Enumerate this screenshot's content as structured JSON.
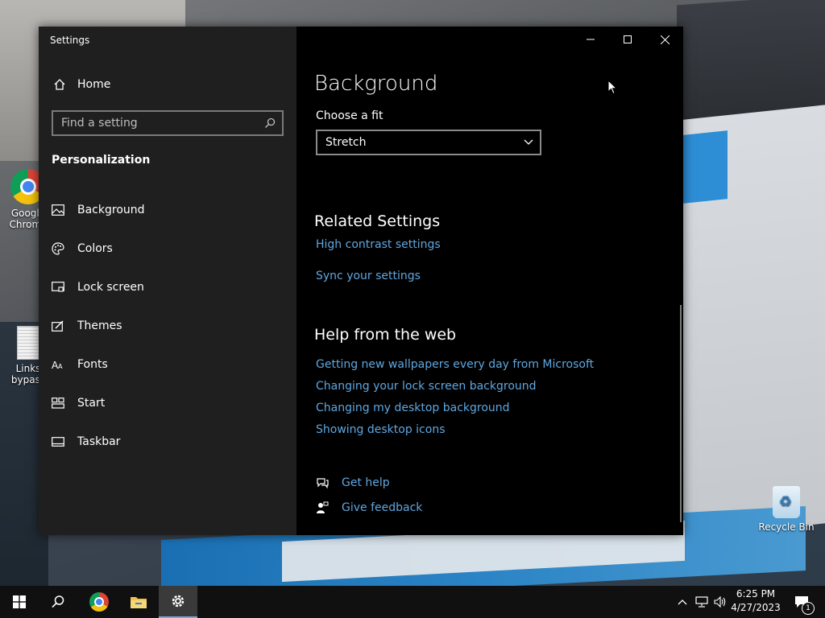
{
  "window": {
    "title": "Settings",
    "minimize_label": "Minimize",
    "maximize_label": "Maximize",
    "close_label": "Close"
  },
  "sidebar": {
    "home_label": "Home",
    "search_placeholder": "Find a setting",
    "section": "Personalization",
    "items": [
      {
        "label": "Background",
        "icon": "picture-icon"
      },
      {
        "label": "Colors",
        "icon": "palette-icon"
      },
      {
        "label": "Lock screen",
        "icon": "lock-screen-icon"
      },
      {
        "label": "Themes",
        "icon": "themes-icon"
      },
      {
        "label": "Fonts",
        "icon": "font-icon"
      },
      {
        "label": "Start",
        "icon": "start-icon"
      },
      {
        "label": "Taskbar",
        "icon": "taskbar-icon"
      }
    ]
  },
  "main": {
    "title": "Background",
    "fit_label": "Choose a fit",
    "fit_value": "Stretch",
    "related": {
      "heading": "Related Settings",
      "links": [
        "High contrast settings",
        "Sync your settings"
      ]
    },
    "help": {
      "heading": "Help from the web",
      "links": [
        "Getting new wallpapers every day from Microsoft",
        "Changing your lock screen background",
        "Changing my desktop background",
        "Showing desktop icons"
      ]
    },
    "get_help": "Get help",
    "give_feedback": "Give feedback"
  },
  "desktop": {
    "icons": [
      {
        "label": "Google Chrome"
      },
      {
        "label": "Links bypass"
      },
      {
        "label": "Recycle Bin"
      }
    ]
  },
  "taskbar": {
    "time": "6:25 PM",
    "date": "4/27/2023",
    "notification_count": "1"
  },
  "colors": {
    "link": "#5fa7e0",
    "sidebar_bg": "#1f1f1f",
    "content_bg": "#000000",
    "taskbar_bg": "#101010"
  }
}
